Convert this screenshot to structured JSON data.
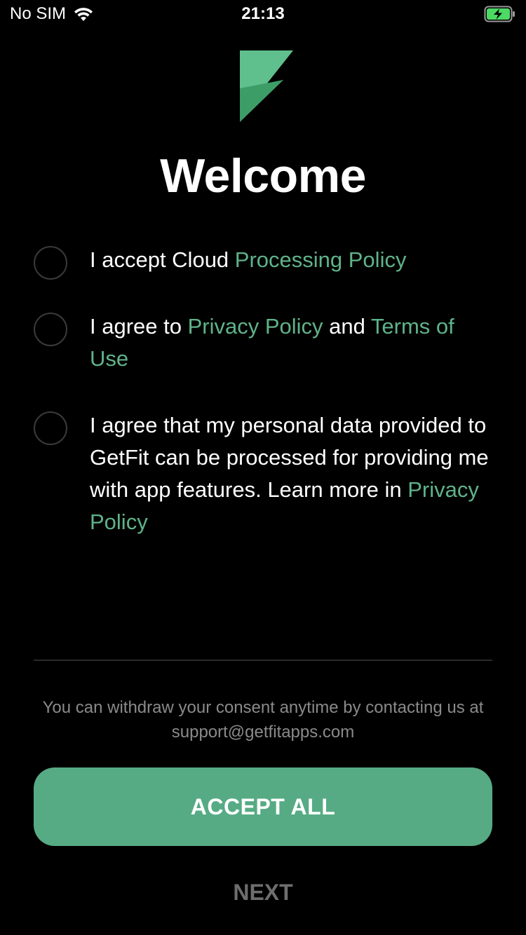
{
  "status_bar": {
    "carrier": "No SIM",
    "time": "21:13",
    "wifi_icon": "wifi-icon",
    "battery_icon": "battery-charging-icon"
  },
  "brand": {
    "logo_icon": "getfit-logo",
    "accent_color": "#5fb38a",
    "button_color": "#56ab84"
  },
  "title": "Welcome",
  "consents": [
    {
      "prefix": "I accept Cloud ",
      "link": "Processing Policy"
    },
    {
      "prefix": "I agree to ",
      "link1": "Privacy Policy",
      "middle": " and ",
      "link2": "Terms of Use"
    },
    {
      "text": "I agree that my personal data provided to GetFit can be processed for providing me with app features. Learn more in ",
      "link": "Privacy Policy"
    }
  ],
  "footnote": "You can withdraw your consent anytime by contacting us at support@getfitapps.com",
  "accept_all_label": "ACCEPT ALL",
  "next_label": "NEXT"
}
